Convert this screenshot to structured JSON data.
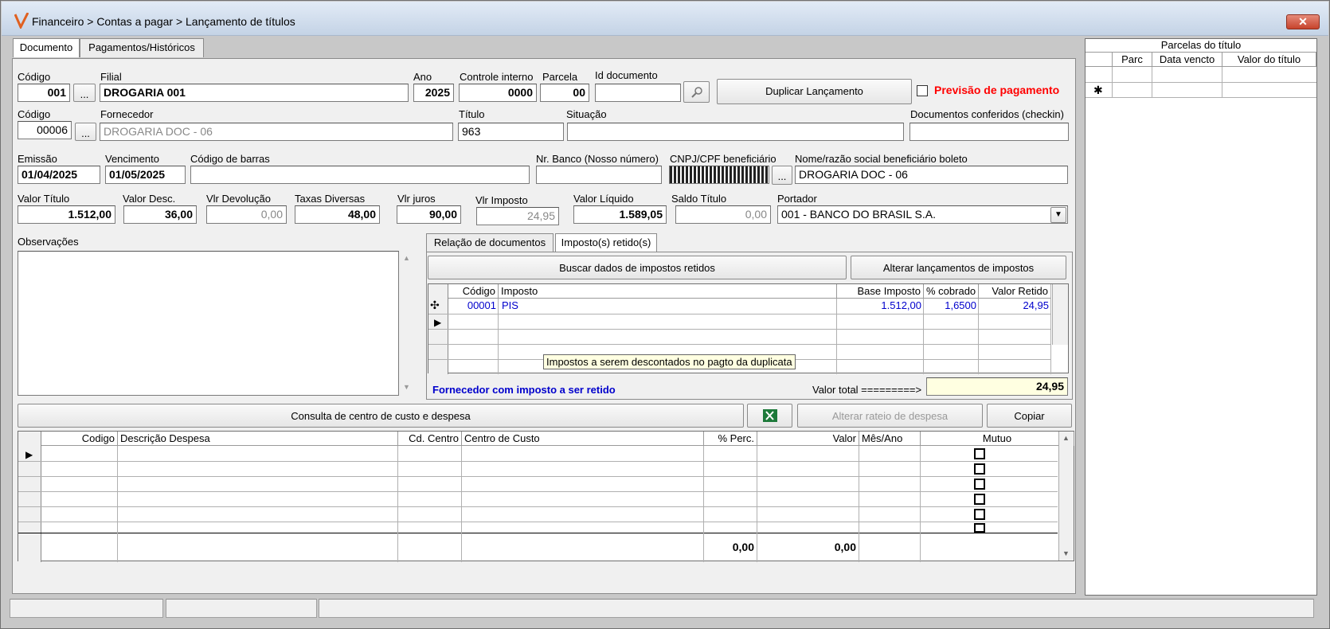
{
  "window": {
    "title": "Financeiro > Contas a pagar > Lançamento de títulos",
    "close_label": "✕"
  },
  "tabs": {
    "documento": "Documento",
    "pagamentos": "Pagamentos/Históricos"
  },
  "header": {
    "codigo_label": "Código",
    "codigo_value": "001",
    "filial_label": "Filial",
    "filial_value": "DROGARIA 001",
    "ano_label": "Ano",
    "ano_value": "2025",
    "controle_label": "Controle interno",
    "controle_value": "0000",
    "parcela_label": "Parcela",
    "parcela_value": "00",
    "iddoc_label": "Id documento",
    "iddoc_value": "",
    "duplicar_label": "Duplicar Lançamento",
    "previsao_label": "Previsão de pagamento",
    "ellipsis": "..."
  },
  "fornecedor": {
    "codigo_label": "Código",
    "codigo_value": "00006",
    "fornecedor_label": "Fornecedor",
    "fornecedor_value": "DROGARIA DOC - 06",
    "titulo_label": "Título",
    "titulo_value": "963",
    "situacao_label": "Situação",
    "situacao_value": "",
    "docs_label": "Documentos conferidos (checkin)",
    "docs_value": ""
  },
  "datas": {
    "emissao_label": "Emissão",
    "emissao_value": "01/04/2025",
    "vencimento_label": "Vencimento",
    "vencimento_value": "01/05/2025",
    "codbarras_label": "Código de barras",
    "codbarras_value": "",
    "nrbanco_label": "Nr. Banco (Nosso número)",
    "nrbanco_value": "",
    "cnpj_label": "CNPJ/CPF beneficiário",
    "nome_label": "Nome/razão social beneficiário boleto",
    "nome_value": "DROGARIA DOC - 06"
  },
  "valores": {
    "valor_titulo_label": "Valor Título",
    "valor_titulo": "1.512,00",
    "valor_desc_label": "Valor Desc.",
    "valor_desc": "36,00",
    "vlr_devolucao_label": "Vlr Devolução",
    "vlr_devolucao": "0,00",
    "taxas_label": "Taxas Diversas",
    "taxas": "48,00",
    "juros_label": "Vlr juros",
    "juros": "90,00",
    "imposto_label": "Vlr Imposto",
    "imposto": "24,95",
    "liquido_label": "Valor Líquido",
    "liquido": "1.589,05",
    "saldo_label": "Saldo Título",
    "saldo": "0,00",
    "portador_label": "Portador",
    "portador": "001 - BANCO DO BRASIL S.A."
  },
  "observacoes": {
    "label": "Observações"
  },
  "impostos": {
    "tab_relacao": "Relação de documentos",
    "tab_impostos": "Imposto(s) retido(s)",
    "buscar_label": "Buscar dados de impostos retidos",
    "alterar_label": "Alterar lançamentos de impostos",
    "columns": [
      "Código",
      "Imposto",
      "Base Imposto",
      "% cobrado",
      "Valor Retido"
    ],
    "rows": [
      {
        "codigo": "00001",
        "imposto": "PIS",
        "base": "1.512,00",
        "cobrado": "1,6500",
        "retido": "24,95"
      }
    ],
    "tooltip": "Impostos a serem descontados no pagto da duplicata",
    "fornecedor_msg": "Fornecedor com imposto a ser retido",
    "total_label": "Valor total =========>",
    "total_value": "24,95"
  },
  "centro_custo": {
    "consulta_label": "Consulta de centro de custo e despesa",
    "alterar_label": "Alterar rateio de despesa",
    "copiar_label": "Copiar",
    "columns": [
      "Codigo",
      "Descrição Despesa",
      "Cd. Centro",
      "Centro de Custo",
      "% Perc.",
      "Valor",
      "Mês/Ano",
      "Mutuo"
    ],
    "total_perc": "0,00",
    "total_valor": "0,00"
  },
  "parcelas": {
    "title": "Parcelas do título",
    "columns": [
      "Parc",
      "Data vencto",
      "Valor do título"
    ],
    "new_row_marker": "✱"
  },
  "colors": {
    "previsao": "#ff0000",
    "link_blue": "#0000cc",
    "tooltip_bg": "#ffffe1",
    "total_bg": "#ffffe1"
  }
}
